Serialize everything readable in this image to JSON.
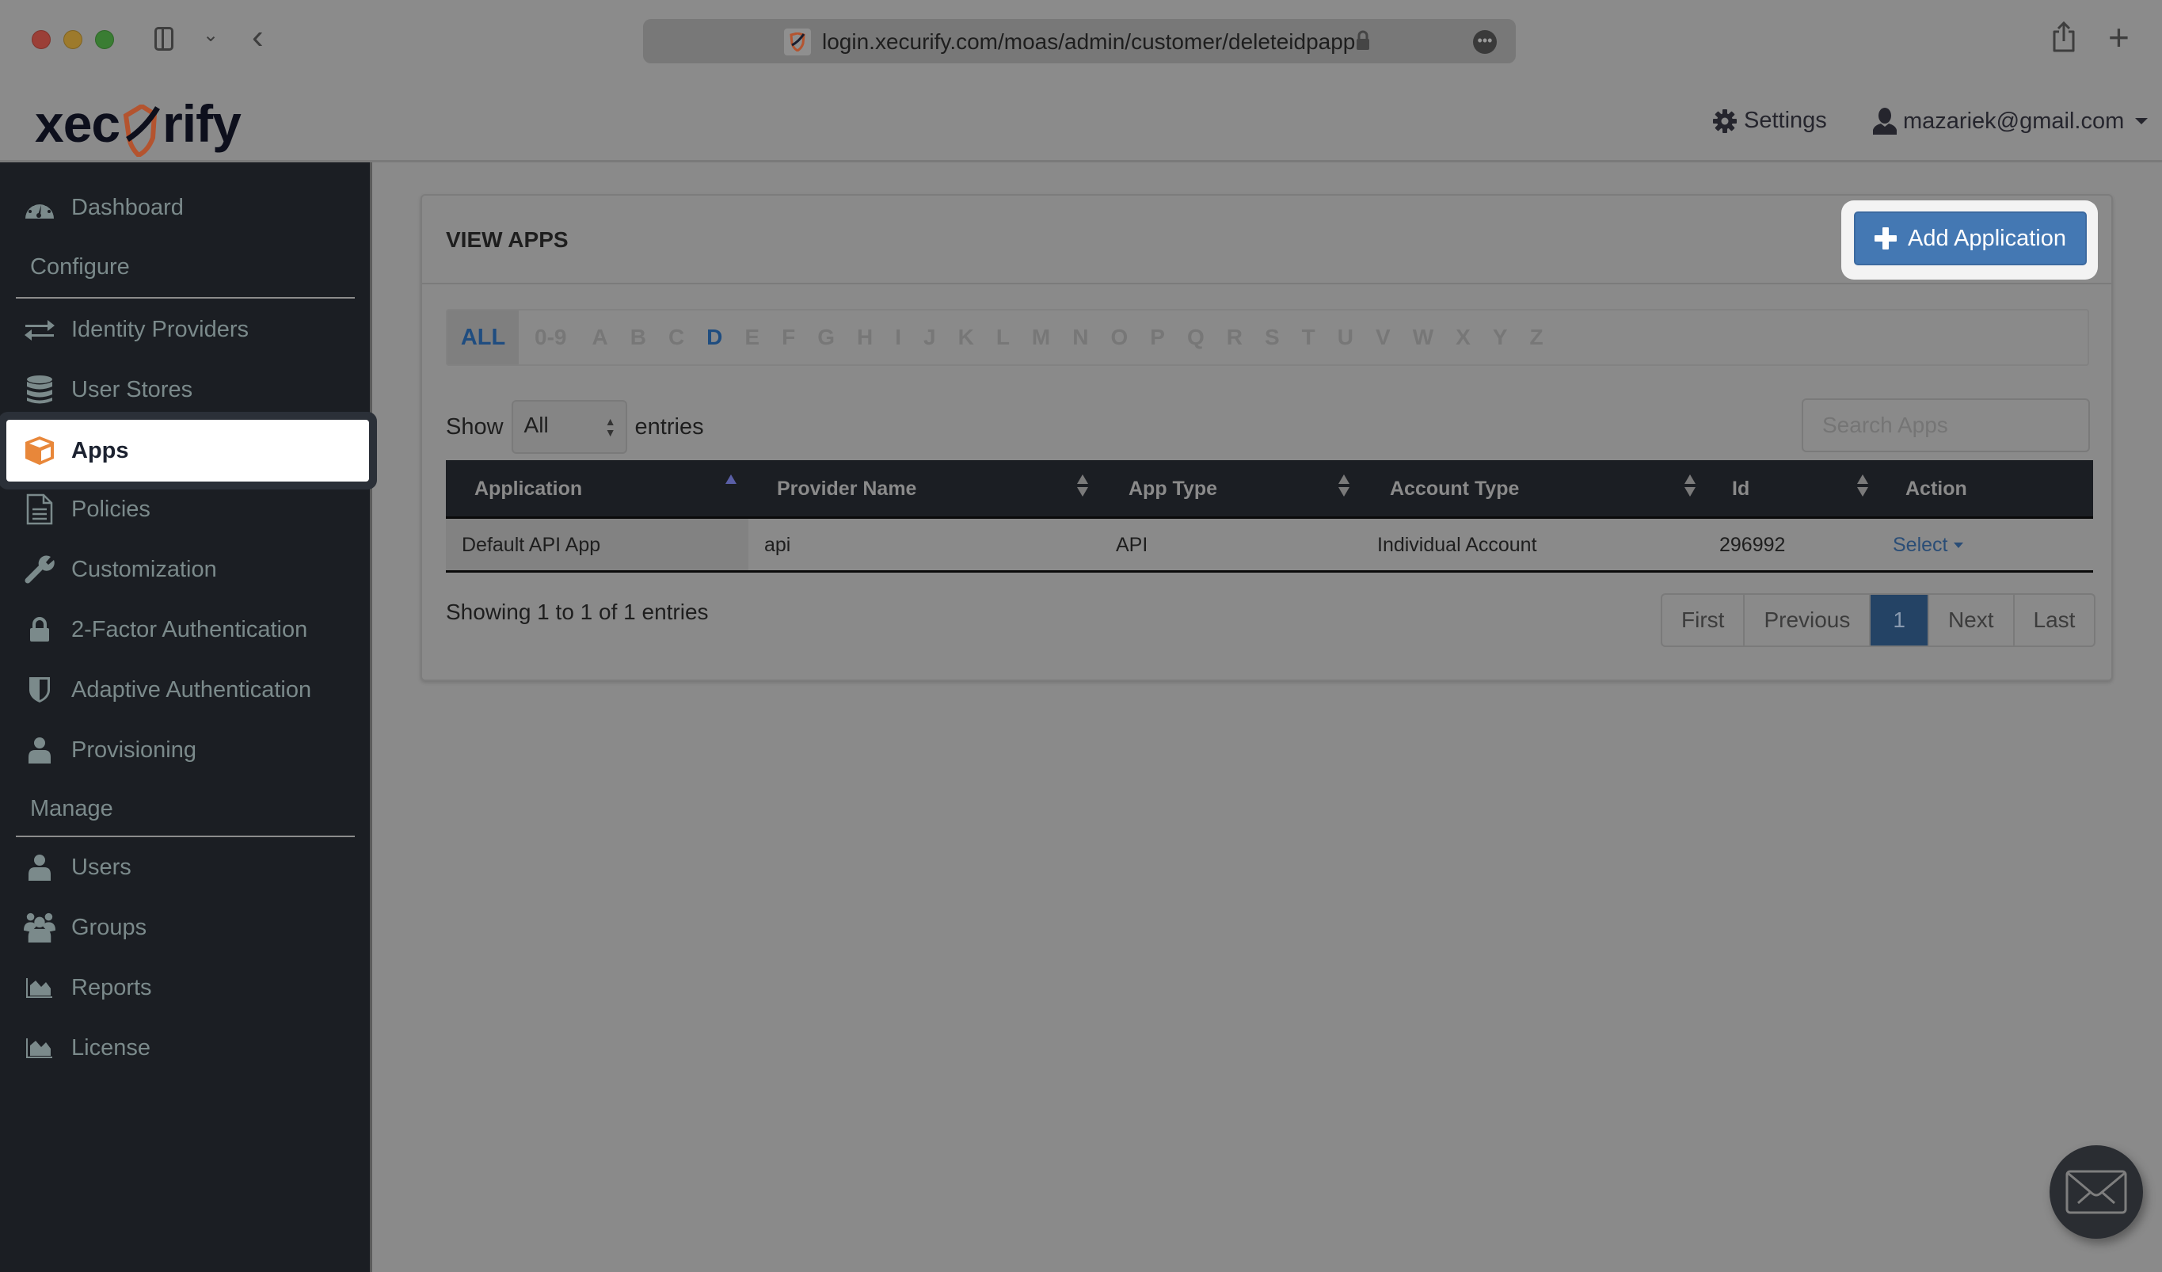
{
  "browser": {
    "url": "login.xecurify.com/moas/admin/customer/deleteidpapp",
    "icons": [
      "sidebar-toggle-icon",
      "chevron-down-icon",
      "back-icon",
      "lock-icon",
      "more-icon",
      "share-icon",
      "new-tab-icon"
    ]
  },
  "header": {
    "logo_left": "xec",
    "logo_right": "rify",
    "settings_label": "Settings",
    "user_email": "mazariek@gmail.com"
  },
  "sidebar": {
    "items": [
      {
        "label": "Dashboard",
        "icon": "dashboard-icon"
      },
      {
        "label": "Identity Providers",
        "icon": "exchange-icon"
      },
      {
        "label": "User Stores",
        "icon": "database-icon"
      },
      {
        "label": "Apps",
        "icon": "cube-icon",
        "active": true
      },
      {
        "label": "Policies",
        "icon": "document-icon"
      },
      {
        "label": "Customization",
        "icon": "wrench-icon"
      },
      {
        "label": "2-Factor Authentication",
        "icon": "lock-icon"
      },
      {
        "label": "Adaptive Authentication",
        "icon": "shield-icon"
      },
      {
        "label": "Provisioning",
        "icon": "user-icon"
      },
      {
        "label": "Users",
        "icon": "user-icon"
      },
      {
        "label": "Groups",
        "icon": "users-icon"
      },
      {
        "label": "Reports",
        "icon": "area-chart-icon"
      },
      {
        "label": "License",
        "icon": "area-chart-icon"
      }
    ],
    "sections": {
      "configure": "Configure",
      "manage": "Manage"
    }
  },
  "panel": {
    "title": "VIEW APPS",
    "add_button": "Add Application",
    "alpha_filter": {
      "all": "ALL",
      "letters": [
        "0-9",
        "A",
        "B",
        "C",
        "D",
        "E",
        "F",
        "G",
        "H",
        "I",
        "J",
        "K",
        "L",
        "M",
        "N",
        "O",
        "P",
        "Q",
        "R",
        "S",
        "T",
        "U",
        "V",
        "W",
        "X",
        "Y",
        "Z"
      ],
      "highlighted": [
        "D"
      ]
    },
    "show_label": "Show",
    "show_value": "All",
    "entries_label": "entries",
    "search_placeholder": "Search Apps",
    "table": {
      "columns": [
        "Application",
        "Provider Name",
        "App Type",
        "Account Type",
        "Id",
        "Action"
      ],
      "sorted_column": "Application",
      "sort_direction": "ascending",
      "rows": [
        {
          "application": "Default API App",
          "provider_name": "api",
          "app_type": "API",
          "account_type": "Individual Account",
          "id": "296992",
          "action": "Select"
        }
      ]
    },
    "info": "Showing 1 to 1 of 1 entries",
    "pagination": {
      "first": "First",
      "previous": "Previous",
      "current": "1",
      "next": "Next",
      "last": "Last"
    }
  },
  "colors": {
    "primary_button": "#4478b3",
    "sidebar_bg": "#1b1e23",
    "active_page": "#244365",
    "accent_orange": "#e8873a",
    "link": "#2a4d76"
  }
}
